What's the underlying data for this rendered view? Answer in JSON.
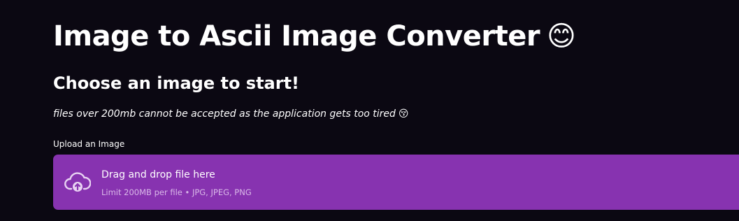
{
  "header": {
    "title": "Image to Ascii Image Converter",
    "title_emoji": "😊",
    "subtitle": "Choose an image to start!",
    "note": "files over 200mb cannot be accepted as the application gets too tired",
    "note_emoji": "😚"
  },
  "uploader": {
    "label": "Upload an Image",
    "drop_text": "Drag and drop file here",
    "limit_text": "Limit 200MB per file • JPG, JPEG, PNG",
    "icon": "cloud-upload-icon",
    "accent": "#8733b0"
  },
  "colors": {
    "background": "#0b0812",
    "dropzone": "#8733b0",
    "text": "#ffffff",
    "muted": "#d9b8e8"
  }
}
